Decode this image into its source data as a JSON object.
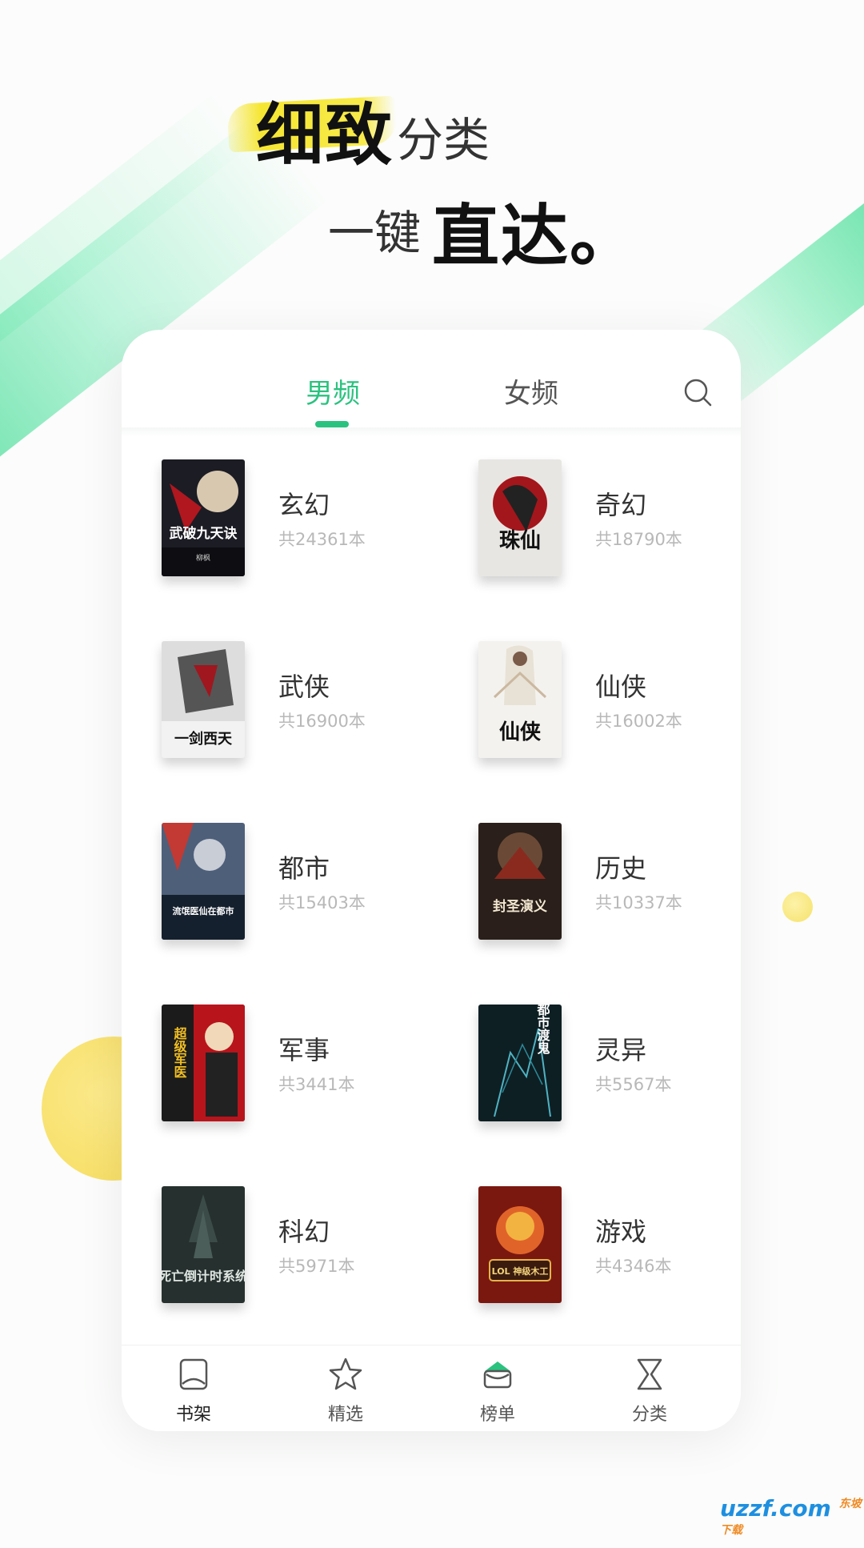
{
  "promo": {
    "line1_big": "细致",
    "line1_small": "分类",
    "line2_small": "一键",
    "line2_big": "直达。"
  },
  "tabs": {
    "male": "男频",
    "female": "女频"
  },
  "categories": [
    {
      "name": "玄幻",
      "count": "共24361本"
    },
    {
      "name": "奇幻",
      "count": "共18790本"
    },
    {
      "name": "武侠",
      "count": "共16900本"
    },
    {
      "name": "仙侠",
      "count": "共16002本"
    },
    {
      "name": "都市",
      "count": "共15403本"
    },
    {
      "name": "历史",
      "count": "共10337本"
    },
    {
      "name": "军事",
      "count": "共3441本"
    },
    {
      "name": "灵异",
      "count": "共5567本"
    },
    {
      "name": "科幻",
      "count": "共5971本"
    },
    {
      "name": "游戏",
      "count": "共4346本"
    }
  ],
  "covers": [
    {
      "title": "武破九天诀",
      "author": "柳枫"
    },
    {
      "title": "珠仙",
      "author": ""
    },
    {
      "title": "一剑西天",
      "author": ""
    },
    {
      "title": "仙侠",
      "author": ""
    },
    {
      "title": "流氓医仙在都市",
      "author": ""
    },
    {
      "title": "封圣演义",
      "author": ""
    },
    {
      "title": "超级军医",
      "author": ""
    },
    {
      "title": "都市渡鬼",
      "author": ""
    },
    {
      "title": "死亡倒计时系统",
      "author": ""
    },
    {
      "title": "LOL 神级木工",
      "author": ""
    }
  ],
  "bottom_nav": [
    {
      "label": "书架",
      "icon": "bookshelf-icon",
      "active": true
    },
    {
      "label": "精选",
      "icon": "star-icon",
      "active": false
    },
    {
      "label": "榜单",
      "icon": "crown-icon",
      "active": false
    },
    {
      "label": "分类",
      "icon": "hourglass-icon",
      "active": false
    }
  ],
  "watermark": {
    "text": "uzzf.com",
    "small": "东坡下载"
  },
  "colors": {
    "accent": "#2ac27f",
    "text_primary": "#333333",
    "text_muted": "#b8b8b8",
    "deco_yellow": "#f6dc5c"
  }
}
